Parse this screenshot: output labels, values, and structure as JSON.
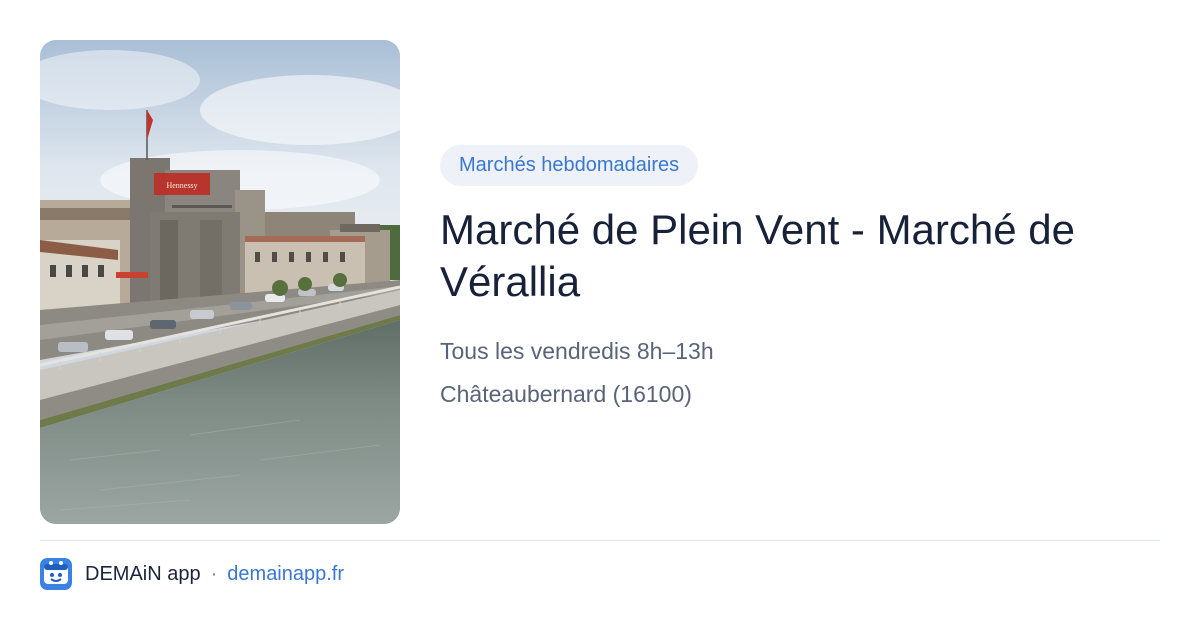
{
  "card": {
    "category": "Marchés hebdomadaires",
    "title": "Marché de Plein Vent - Marché de Vérallia",
    "schedule": "Tous les vendredis 8h–13h",
    "location": "Châteaubernard (16100)"
  },
  "photo": {
    "sign_text": "Hennessy"
  },
  "footer": {
    "app_name": "DEMAiN app",
    "separator": "·",
    "site": "demainapp.fr"
  },
  "colors": {
    "accent": "#3a78d0",
    "tag_background": "#eef2f8",
    "title": "#18213a",
    "muted": "#5a6478"
  }
}
